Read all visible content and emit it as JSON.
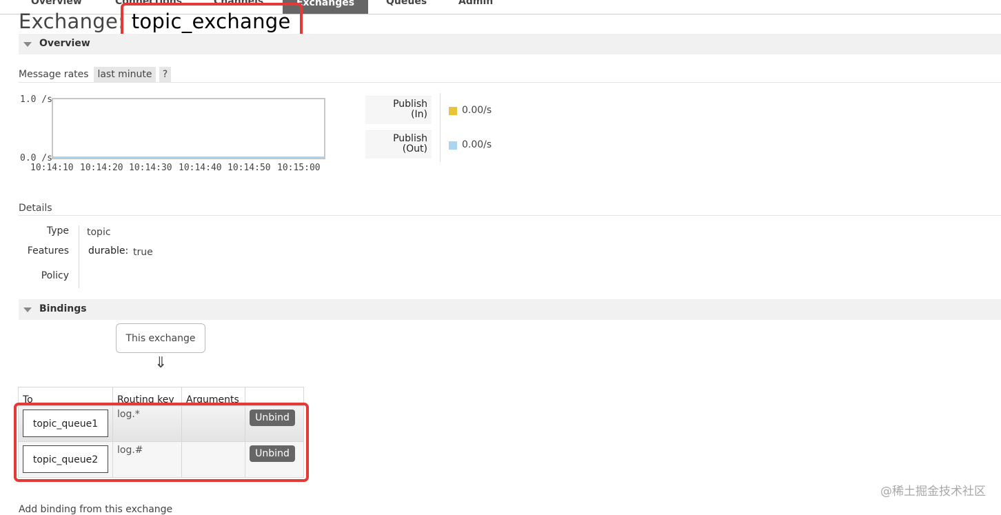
{
  "nav": {
    "tabs": [
      {
        "label": "Overview"
      },
      {
        "label": "Connections"
      },
      {
        "label": "Channels"
      },
      {
        "label": "Exchanges",
        "active": true
      },
      {
        "label": "Queues"
      },
      {
        "label": "Admin"
      }
    ]
  },
  "page": {
    "title_prefix": "Exchange:",
    "title_name": "topic_exchange"
  },
  "overview": {
    "section_label": "Overview",
    "message_rates_label": "Message rates",
    "range_pill": "last minute",
    "help_pill": "?",
    "chart": {
      "y_max_label": "1.0 /s",
      "y_min_label": "0.0 /s",
      "x_ticks": [
        "10:14:10",
        "10:14:20",
        "10:14:30",
        "10:14:40",
        "10:14:50",
        "10:15:00"
      ]
    },
    "rates": [
      {
        "line1": "Publish",
        "line2": "(In)",
        "value": "0.00/s",
        "color": "#e9c43b"
      },
      {
        "line1": "Publish",
        "line2": "(Out)",
        "value": "0.00/s",
        "color": "#aad4ef"
      }
    ]
  },
  "details": {
    "heading": "Details",
    "type_label": "Type",
    "type_value": "topic",
    "features_label": "Features",
    "features_key": "durable:",
    "features_value": "true",
    "policy_label": "Policy"
  },
  "bindings": {
    "section_label": "Bindings",
    "this_exchange": "This exchange",
    "arrow": "⇓",
    "columns": [
      "To",
      "Routing key",
      "Arguments",
      ""
    ],
    "rows": [
      {
        "to": "topic_queue1",
        "routing_key": "log.*",
        "arguments": "",
        "action": "Unbind"
      },
      {
        "to": "topic_queue2",
        "routing_key": "log.#",
        "arguments": "",
        "action": "Unbind"
      }
    ]
  },
  "footer": {
    "add_binding_text": "Add binding from this exchange"
  },
  "watermark": "@稀土掘金技术社区",
  "colors": {
    "highlight": "#e53935",
    "active_tab": "#666666"
  }
}
